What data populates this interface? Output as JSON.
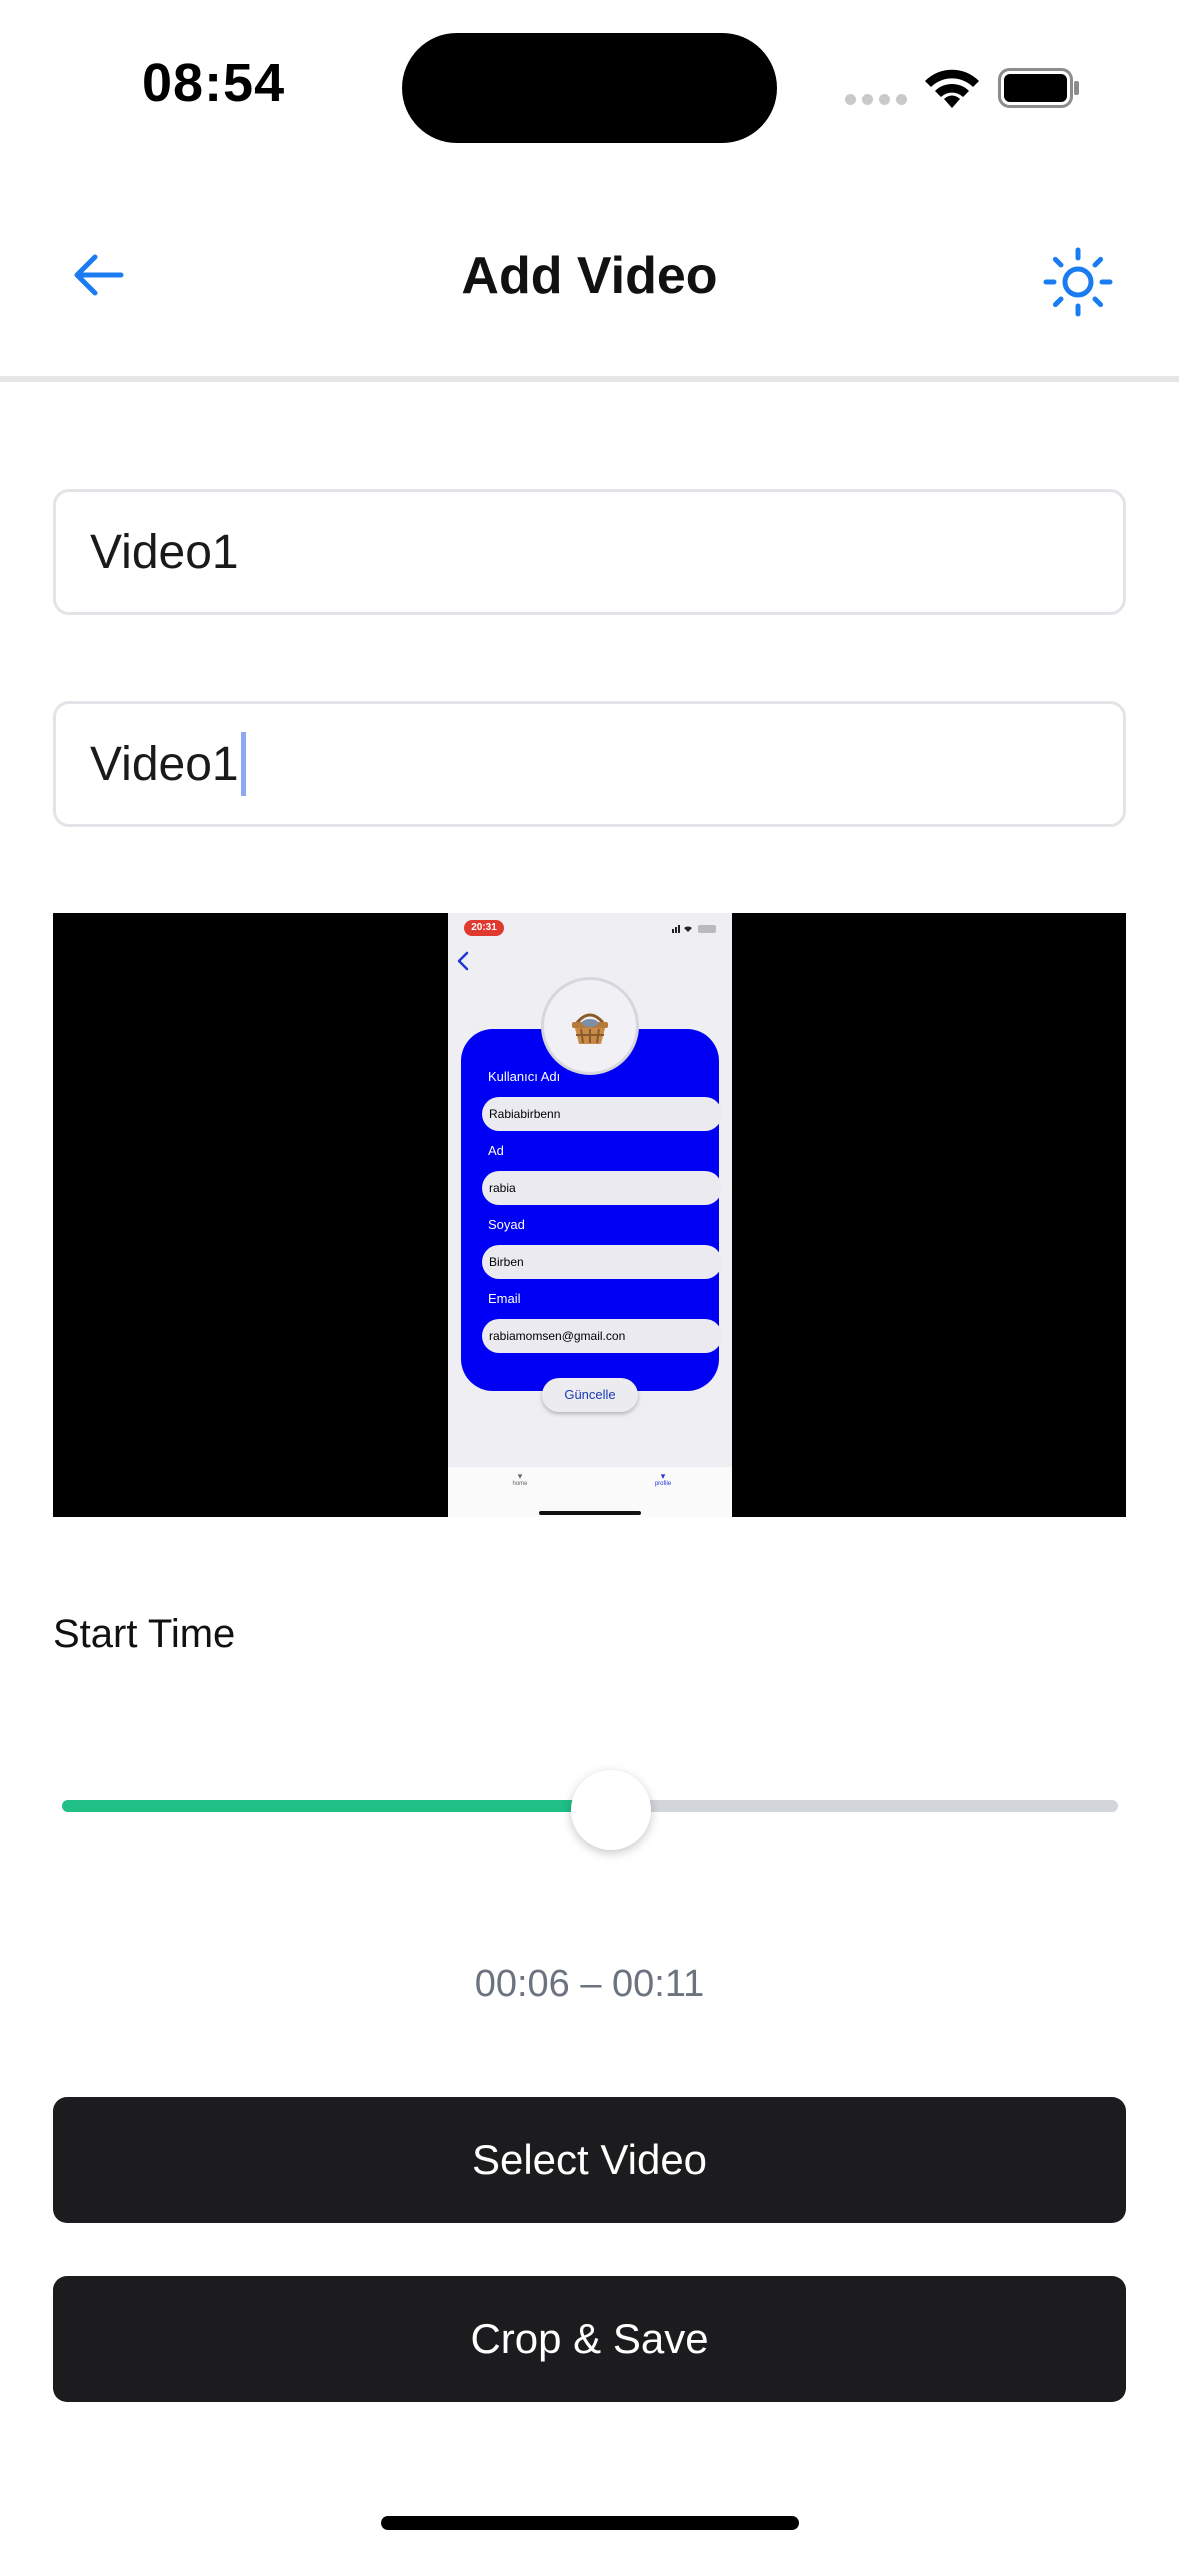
{
  "status_bar": {
    "time": "08:54"
  },
  "nav": {
    "title": "Add Video",
    "back_icon": "arrow-left-icon",
    "theme_icon": "sun-icon",
    "accent_color": "#1a7cf0"
  },
  "form": {
    "field_1_value": "Video1",
    "field_2_value": "Video1"
  },
  "video_preview": {
    "time": "20:31",
    "fields": [
      {
        "label": "Kullanıcı Adı",
        "value": "Rabiabirbenn"
      },
      {
        "label": "Ad",
        "value": "rabia"
      },
      {
        "label": "Soyad",
        "value": "Birben"
      },
      {
        "label": "Email",
        "value": "rabiamomsen@gmail.con"
      }
    ],
    "button_label": "Güncelle",
    "tabs": [
      "home",
      "profile"
    ]
  },
  "trim": {
    "label": "Start Time",
    "slider_fraction": 0.52,
    "range_text": "00:06 – 00:11",
    "fill_color": "#1fbf85"
  },
  "actions": {
    "select_label": "Select Video",
    "crop_label": "Crop & Save"
  }
}
